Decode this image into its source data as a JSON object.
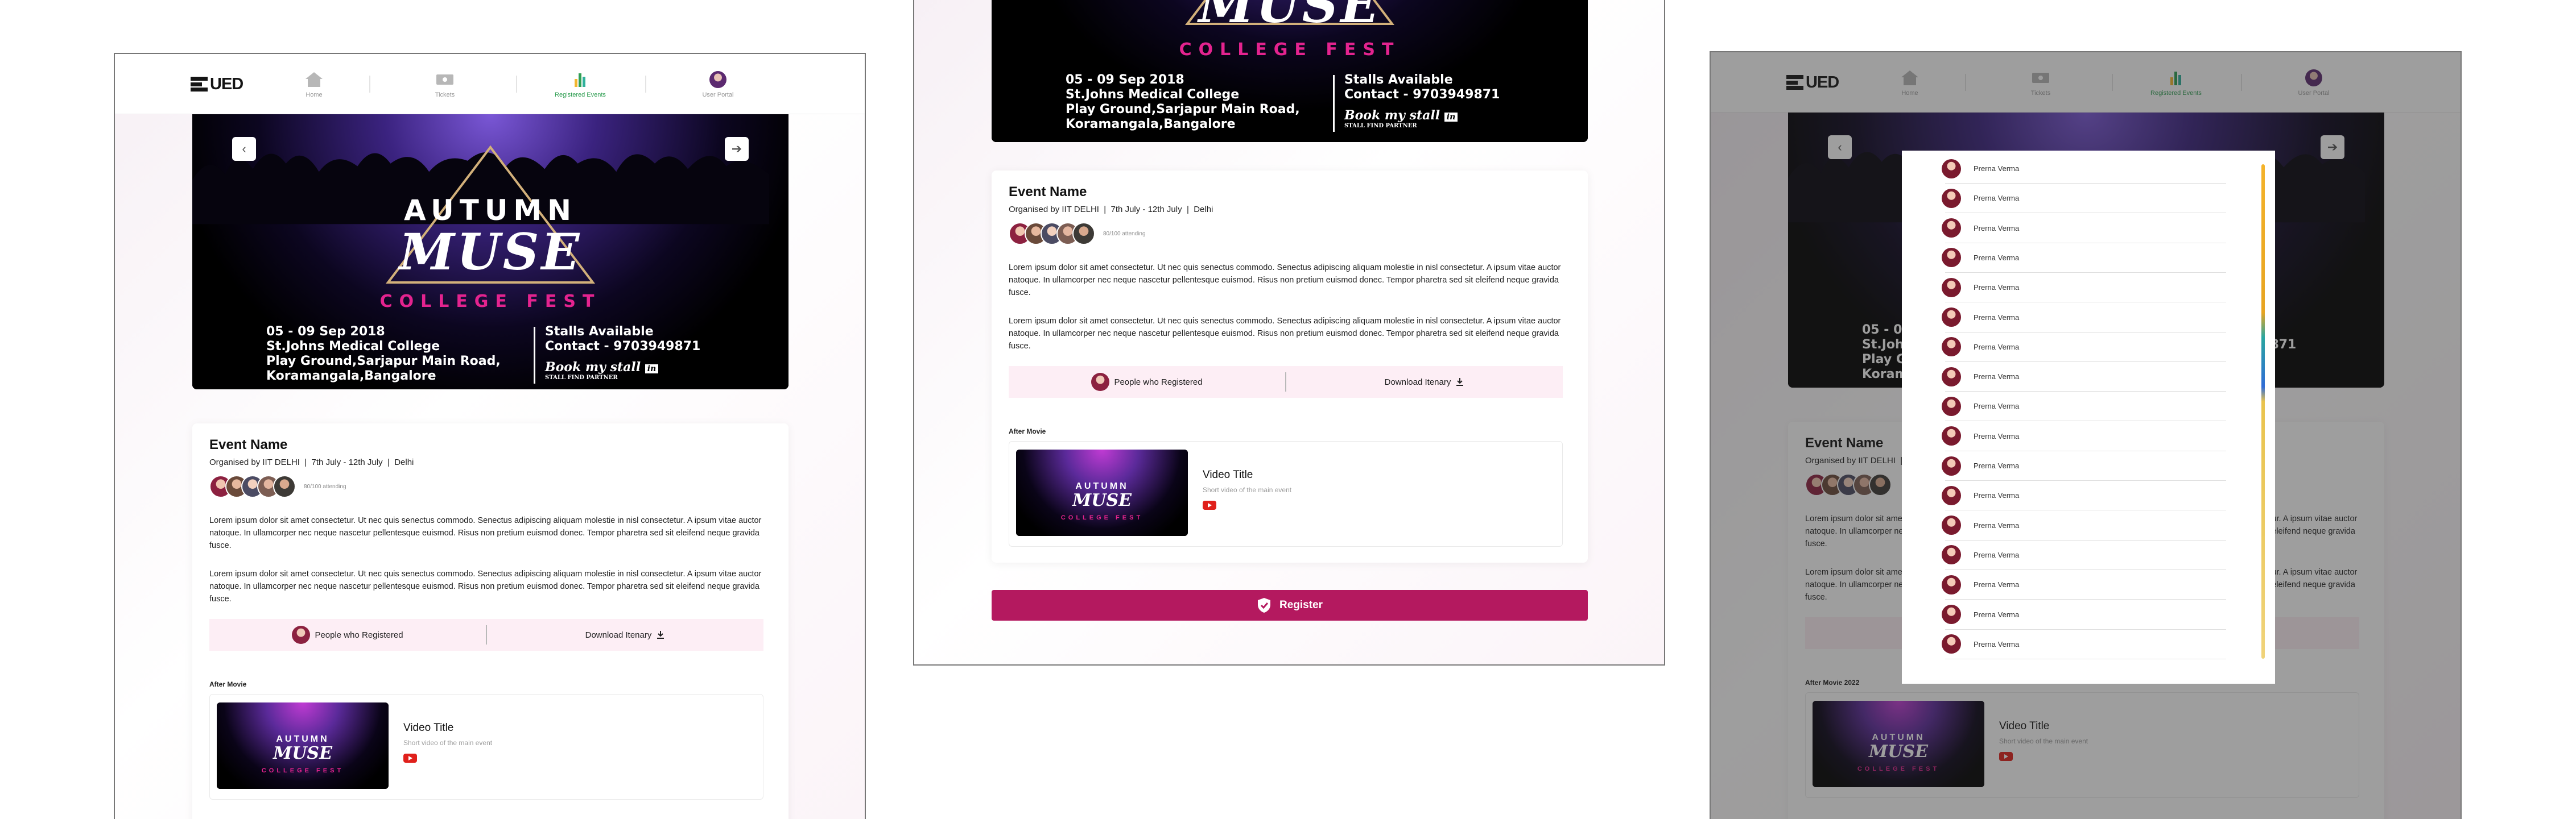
{
  "nav": {
    "logo_text": "UED",
    "items": [
      {
        "label": "Home",
        "icon": "home-icon"
      },
      {
        "label": "Tickets",
        "icon": "ticket-icon"
      },
      {
        "label": "Registered Events",
        "icon": "bar-chart-icon",
        "active": true
      },
      {
        "label": "User Portal",
        "icon": "avatar-icon"
      }
    ]
  },
  "poster": {
    "line1": "AUTUMN",
    "line2": "MUSE",
    "line3": "COLLEGE FEST",
    "dates": "05 - 09 Sep 2018",
    "venue1": "St.Johns Medical College",
    "venue2": "Play Ground,Sarjapur Main Road,",
    "venue3": "Koramangala,Bangalore",
    "stalls": "Stalls Available",
    "contact": "Contact - 9703949871",
    "partner_brand": "Book my stall",
    "partner_badge": "in",
    "partner_tag": "STALL FIND PARTNER"
  },
  "event": {
    "name": "Event Name",
    "organised_by": "Organised by IIT DELHI",
    "dates": "7th July - 12th July",
    "location": "Delhi",
    "attending": "80/100 attending",
    "description1": "Lorem ipsum dolor sit amet consectetur. Ut nec quis senectus commodo. Senectus adipiscing aliquam molestie in nisl consectetur. A ipsum vitae auctor natoque. In ullamcorper nec neque nascetur pellentesque euismod. Risus non pretium euismod donec. Tempor pharetra sed sit eleifend neque gravida fusce.",
    "description2": "Lorem ipsum dolor sit amet consectetur. Ut nec quis senectus commodo. Senectus adipiscing aliquam molestie in nisl consectetur. A ipsum vitae auctor natoque. In ullamcorper nec neque nascetur pellentesque euismod. Risus non pretium euismod donec. Tempor pharetra sed sit eleifend neque gravida fusce.",
    "people_registered": "People who Registered",
    "download_itinerary": "Download Itenary",
    "after_movie_label": "After Movie",
    "after_movie_label_alt": "After Movie 2022",
    "video_title": "Video Title",
    "video_subtitle": "Short video of the main event",
    "register_label": "Register"
  },
  "registered_people": [
    "Prerna Verma",
    "Prerna Verma",
    "Prerna Verma",
    "Prerna Verma",
    "Prerna Verma",
    "Prerna Verma",
    "Prerna Verma",
    "Prerna Verma",
    "Prerna Verma",
    "Prerna Verma",
    "Prerna Verma",
    "Prerna Verma",
    "Prerna Verma",
    "Prerna Verma",
    "Prerna Verma",
    "Prerna Verma",
    "Prerna Verma"
  ],
  "colors": {
    "brand": "#b4195f",
    "accent_pink": "#e4238f",
    "action_bar": "#fdeef5",
    "active_nav": "#2f9e52"
  }
}
